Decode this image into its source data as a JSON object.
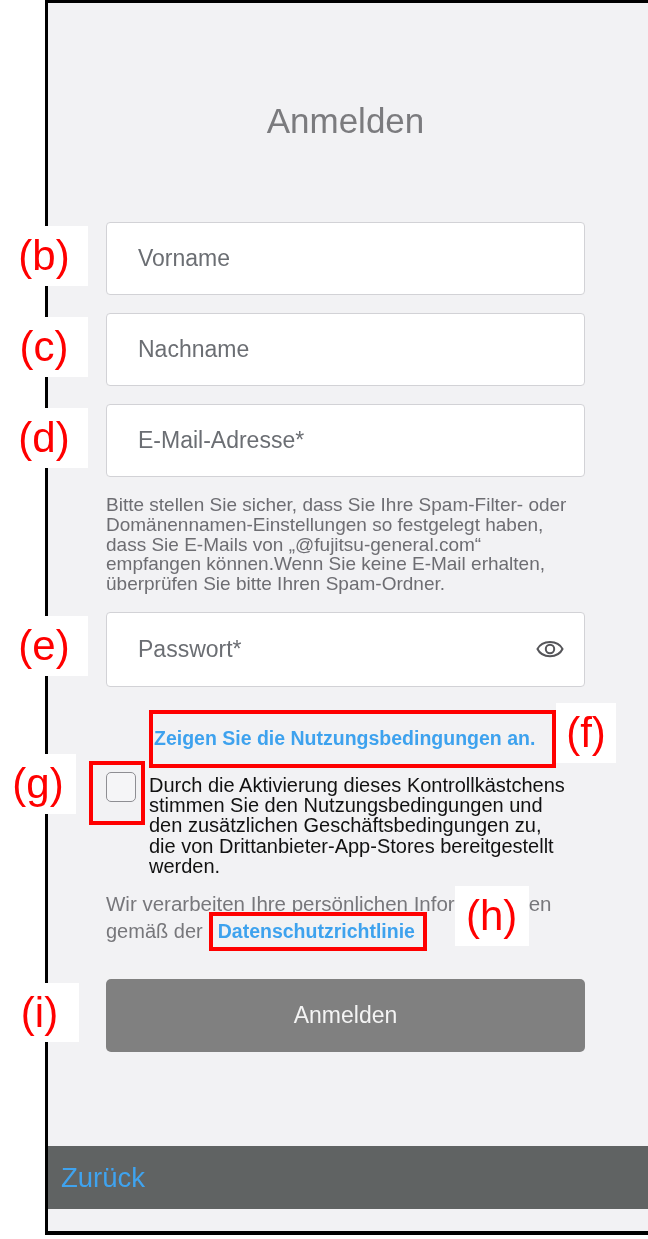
{
  "screen": {
    "title": "Anmelden"
  },
  "fields": [
    {
      "kind": "text",
      "placeholder": "Vorname",
      "annotation": {
        "label": "(b)",
        "framed": false
      }
    },
    {
      "kind": "text",
      "placeholder": "Nachname",
      "annotation": {
        "label": "(c)",
        "framed": false
      }
    },
    {
      "kind": "text",
      "placeholder": "E-Mail-Adresse*",
      "hint": "Bitte stellen Sie sicher, dass Sie Ihre Spam-Filter- oder\nDomänennamen-Einstellungen so festgelegt haben,\ndass Sie E-Mails von „@fujitsu-general.com“\nempfangen können.Wenn Sie keine E-Mail erhalten,\nüberprüfen Sie bitte Ihren Spam-Ordner.",
      "annotation": {
        "label": "(d)",
        "framed": false
      }
    },
    {
      "kind": "password",
      "placeholder": "Passwort*",
      "annotation": {
        "label": "(e)",
        "framed": false
      }
    }
  ],
  "terms_link": {
    "text": "Zeigen Sie die Nutzungsbedingungen an.",
    "annotation": {
      "label": "(f)",
      "framed": true
    }
  },
  "consent": {
    "checked": false,
    "text": "Durch die Aktivierung dieses Kontrollkästchens\nstimmen Sie den Nutzungsbedingungen und\nden zusätzlichen Geschäftsbedingungen zu,\ndie von Drittanbieter-App-Stores bereitgestellt\nwerden.",
    "annotation": {
      "label": "(g)",
      "framed": true
    }
  },
  "privacy_notice": {
    "text_start": "Wir verarbeiten Ihre persönlichen Infor",
    "text_end": "en",
    "lead_in": "gemäß der",
    "link": {
      "text": "Datenschutzrichtlinie",
      "annotation": {
        "label": "(h)",
        "framed": true
      }
    }
  },
  "submit_button": {
    "label": "Anmelden",
    "disabled": true,
    "annotation": {
      "label": "(i)",
      "framed": false
    }
  },
  "bottom_bar": {
    "back_link": "Zurück"
  }
}
